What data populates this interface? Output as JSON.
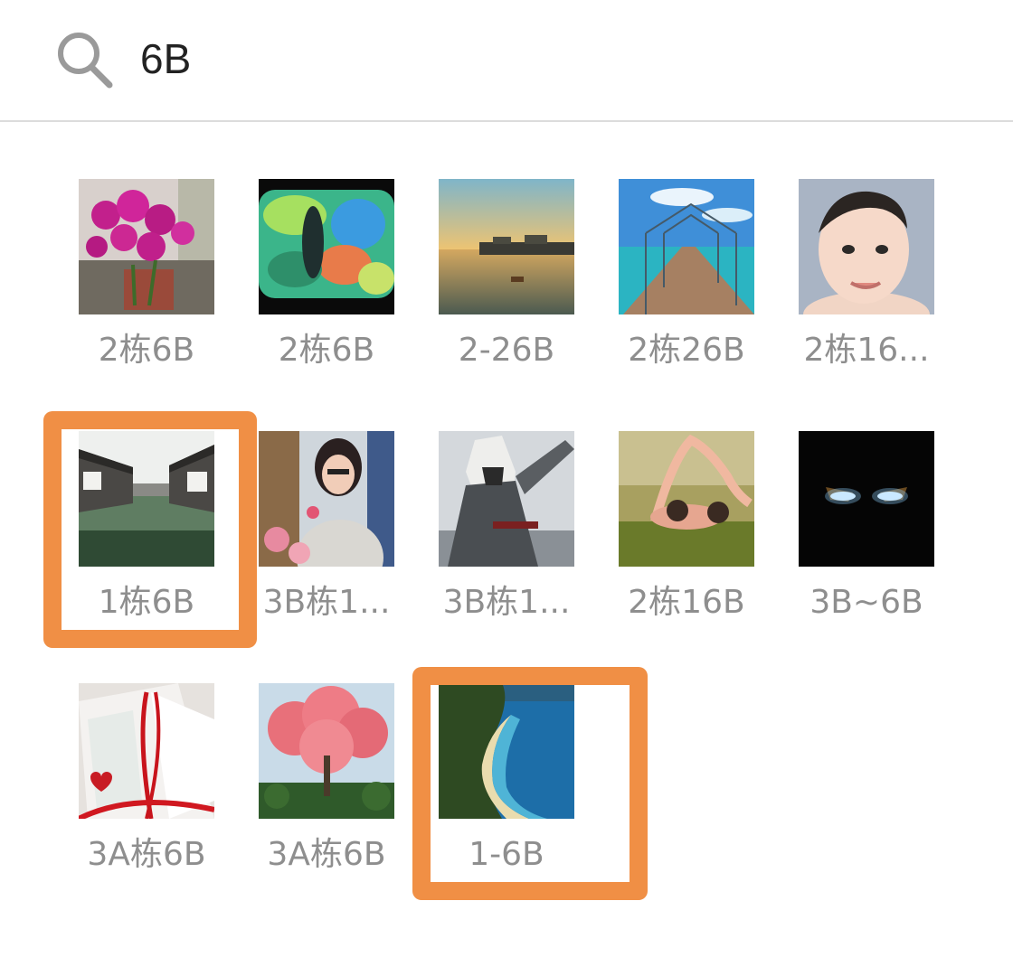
{
  "search": {
    "query": "6B"
  },
  "results": [
    {
      "label": "2栋6B",
      "thumb": "orchid-flowers-photo"
    },
    {
      "label": "2栋6B",
      "thumb": "blurred-screen-photo"
    },
    {
      "label": "2-26B",
      "thumb": "river-sunset-photo"
    },
    {
      "label": "2栋26B",
      "thumb": "seaside-pier-photo"
    },
    {
      "label": "2栋16...",
      "thumb": "baby-portrait-photo"
    },
    {
      "label": "1栋6B",
      "thumb": "water-town-canal-photo",
      "highlighted": true
    },
    {
      "label": "3B栋1...",
      "thumb": "woman-with-flowers-photo"
    },
    {
      "label": "3B栋1...",
      "thumb": "hooded-assassin-photo"
    },
    {
      "label": "2栋16B",
      "thumb": "couple-lying-on-grass-photo"
    },
    {
      "label": "3B~6B",
      "thumb": "glowing-eyes-mask-photo"
    },
    {
      "label": "3A栋6B",
      "thumb": "love-you-card-photo"
    },
    {
      "label": "3A栋6B",
      "thumb": "pink-blossom-tree-photo"
    },
    {
      "label": "1-6B",
      "thumb": "tropical-beach-photo",
      "highlighted": true
    }
  ],
  "colors": {
    "highlight": "#f08f45",
    "label_text": "#8e8e8e",
    "divider": "#dcdcdc"
  }
}
